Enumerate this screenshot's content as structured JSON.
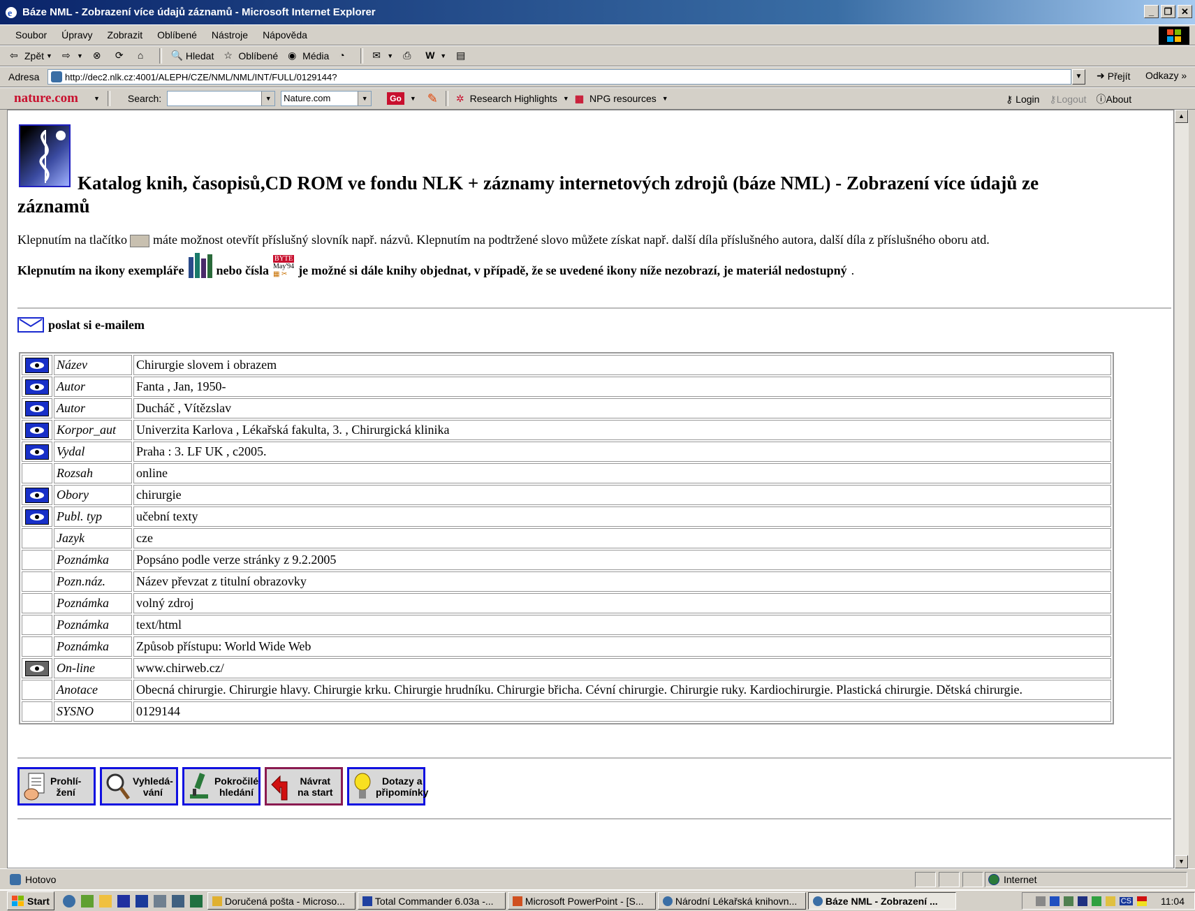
{
  "window": {
    "title": "Báze NML - Zobrazení více údajů záznamů - Microsoft Internet Explorer"
  },
  "menu": [
    "Soubor",
    "Úpravy",
    "Zobrazit",
    "Oblíbené",
    "Nástroje",
    "Nápověda"
  ],
  "toolbar": {
    "back": "Zpět",
    "search": "Hledat",
    "favorites": "Oblíbené",
    "media": "Média"
  },
  "address": {
    "label": "Adresa",
    "url": "http://dec2.nlk.cz:4001/ALEPH/CZE/NML/NML/INT/FULL/0129144?",
    "go": "Přejít",
    "links": "Odkazy"
  },
  "nature_toolbar": {
    "brand": "nature.com",
    "search_label": "Search:",
    "search_value": "",
    "scope": "Nature.com",
    "go": "Go",
    "research": "Research Highlights",
    "npg": "NPG resources",
    "login": "Login",
    "logout": "Logout",
    "about": "About"
  },
  "page": {
    "title": "Katalog knih, časopisů,CD ROM ve fondu NLK + záznamy internetových zdrojů (báze NML) - Zobrazení více údajů ze záznamů",
    "info_before": "Klepnutím na tlačítko",
    "info_after": "máte možnost otevřít příslušný slovník např. názvů. Klepnutím na podtržené slovo můžete získat např. další díla příslušného autora, další díla z příslušného oboru atd.",
    "order_a": "Klepnutím na ikony exempláře",
    "order_b": "nebo čísla",
    "order_c": "je možné si dále knihy objednat, v případě, že se uvedené ikony níže nezobrazí, je materiál nedostupný",
    "order_end": ".",
    "byte_label": "BYTE",
    "byte_date": "May'94",
    "email": "poslat si e-mailem"
  },
  "record": [
    {
      "icon": true,
      "label": "Název",
      "value": "Chirurgie slovem i obrazem"
    },
    {
      "icon": true,
      "label": "Autor",
      "value": "Fanta , Jan, 1950-"
    },
    {
      "icon": true,
      "label": "Autor",
      "value": "Ducháč , Vítězslav"
    },
    {
      "icon": true,
      "label": "Korpor_aut",
      "value": "Univerzita Karlova , Lékařská fakulta, 3. , Chirurgická klinika"
    },
    {
      "icon": true,
      "label": "Vydal",
      "value": "Praha : 3. LF UK , c2005."
    },
    {
      "icon": false,
      "label": "Rozsah",
      "value": "online"
    },
    {
      "icon": true,
      "label": "Obory",
      "value": "chirurgie"
    },
    {
      "icon": true,
      "label": "Publ. typ",
      "value": "učební texty"
    },
    {
      "icon": false,
      "label": "Jazyk",
      "value": "cze"
    },
    {
      "icon": false,
      "label": "Poznámka",
      "value": "Popsáno podle verze stránky z 9.2.2005"
    },
    {
      "icon": false,
      "label": "Pozn.náz.",
      "value": "Název převzat z titulní obrazovky"
    },
    {
      "icon": false,
      "label": "Poznámka",
      "value": "volný zdroj"
    },
    {
      "icon": false,
      "label": "Poznámka",
      "value": "text/html"
    },
    {
      "icon": false,
      "label": "Poznámka",
      "value": "Způsob přístupu: World Wide Web"
    },
    {
      "icon": true,
      "icon_style": "grey",
      "label": "On-line",
      "value": "www.chirweb.cz/"
    },
    {
      "icon": false,
      "label": "Anotace",
      "value": "Obecná chirurgie. Chirurgie hlavy. Chirurgie krku. Chirurgie hrudníku. Chirurgie břicha. Cévní chirurgie. Chirurgie ruky. Kardiochirurgie. Plastická chirurgie. Dětská chirurgie."
    },
    {
      "icon": false,
      "label": "SYSNO",
      "value": "0129144"
    }
  ],
  "nav_buttons": [
    {
      "l1": "Prohlí-",
      "l2": "žení",
      "icon": "hand-icon"
    },
    {
      "l1": "Vyhledá-",
      "l2": "vání",
      "icon": "magnifier-icon"
    },
    {
      "l1": "Pokročilé",
      "l2": "hledání",
      "icon": "microscope-icon"
    },
    {
      "l1": "Návrat",
      "l2": "na start",
      "icon": "return-arrow-icon"
    },
    {
      "l1": "Dotazy a",
      "l2": "připomínky",
      "icon": "lightbulb-icon"
    }
  ],
  "status": {
    "text": "Hotovo",
    "zone": "Internet"
  },
  "taskbar": {
    "start": "Start",
    "tasks": [
      "Doručená pošta - Microso...",
      "Total Commander 6.03a -...",
      "Microsoft PowerPoint - [S...",
      "Národní Lékařská knihovn...",
      "Báze NML - Zobrazení ..."
    ],
    "clock": "11:04",
    "lang": "CS"
  },
  "colors": {
    "accent": "#0a246a",
    "link_border": "#1010e0",
    "eye_blue": "#1830c8"
  }
}
